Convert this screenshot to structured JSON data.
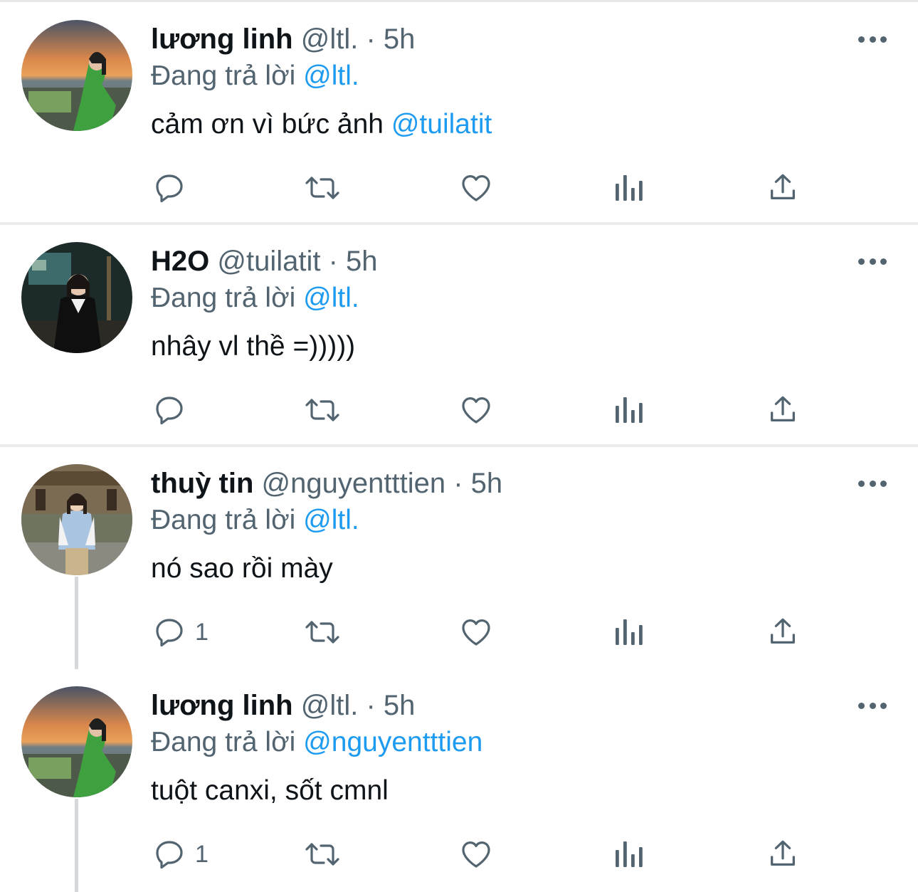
{
  "tweets": [
    {
      "name": "lương linh",
      "handle": "@ltl.",
      "time": "· 5h",
      "reply_prefix": "Đang trả lời",
      "reply_to": "@ltl.",
      "text": "cảm ơn vì bức ảnh",
      "text_mention": "@tuilatit",
      "reply_count": ""
    },
    {
      "name": "H2O",
      "handle": "@tuilatit",
      "time": "· 5h",
      "reply_prefix": "Đang trả lời",
      "reply_to": "@ltl.",
      "text": "nhây vl thề =)))))",
      "text_mention": "",
      "reply_count": ""
    },
    {
      "name": "thuỳ tin",
      "handle": "@nguyentttien",
      "time": "· 5h",
      "reply_prefix": "Đang trả lời",
      "reply_to": "@ltl.",
      "text": "nó sao rồi mày",
      "text_mention": "",
      "reply_count": "1"
    },
    {
      "name": "lương linh",
      "handle": "@ltl.",
      "time": "· 5h",
      "reply_prefix": "Đang trả lời",
      "reply_to": "@nguyentttien",
      "text": "tuột canxi, sốt cmnl",
      "text_mention": "",
      "reply_count": "1"
    }
  ],
  "icons": {
    "reply": "speech-bubble-icon",
    "retweet": "retweet-arrows-icon",
    "like": "heart-icon",
    "views": "bar-chart-icon",
    "share": "share-upload-icon",
    "more": "more-dots-icon"
  },
  "colors": {
    "text": "#0f1419",
    "secondary": "#536471",
    "accent": "#1d9bf0",
    "divider": "#e9ebed",
    "thread_line": "#d5d9dc"
  }
}
